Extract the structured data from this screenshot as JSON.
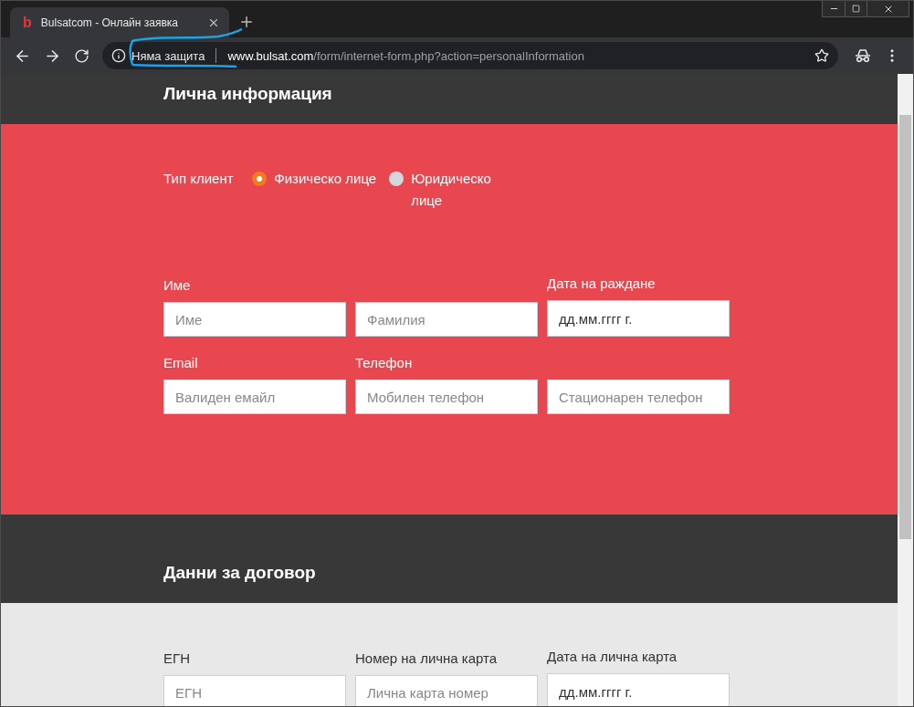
{
  "browser": {
    "tab": {
      "logo": "b",
      "title": "Bulsatcom - Онлайн заявка",
      "selected": true
    },
    "address": {
      "security_label": "Няма защита",
      "domain": "www.bulsat.com",
      "path": "/form/internet-form.php?action=personalInformation"
    }
  },
  "sections": [
    {
      "kind": "heading",
      "title": "Лична информация"
    },
    {
      "kind": "accent",
      "client_type": {
        "label": "Тип клиент",
        "options": [
          {
            "label": "Физическо лице",
            "selected": true
          },
          {
            "label": "Юридическо лице",
            "selected": false
          }
        ]
      },
      "rows": [
        [
          {
            "kind": "text",
            "label": "Име",
            "placeholder": "Име"
          },
          {
            "kind": "text",
            "placeholder": "Фамилия"
          },
          {
            "kind": "date",
            "label": "Дата на раждане",
            "value": "дд.мм.гггг г."
          }
        ],
        [
          {
            "kind": "text",
            "label": "Email",
            "placeholder": "Валиден емайл"
          },
          {
            "kind": "text",
            "label": "Телефон",
            "placeholder": "Мобилен телефон"
          },
          {
            "kind": "text",
            "placeholder": "Стационарен телефон"
          }
        ]
      ]
    },
    {
      "kind": "heading",
      "title": "Данни за договор"
    },
    {
      "kind": "plain",
      "rows": [
        [
          {
            "kind": "text",
            "label": "ЕГН",
            "placeholder": "ЕГН"
          },
          {
            "kind": "text",
            "label": "Номер на лична карта",
            "placeholder": "Лична карта номер"
          },
          {
            "kind": "date",
            "label": "Дата на лична карта",
            "value": "дд.мм.гггг г."
          }
        ]
      ]
    }
  ]
}
